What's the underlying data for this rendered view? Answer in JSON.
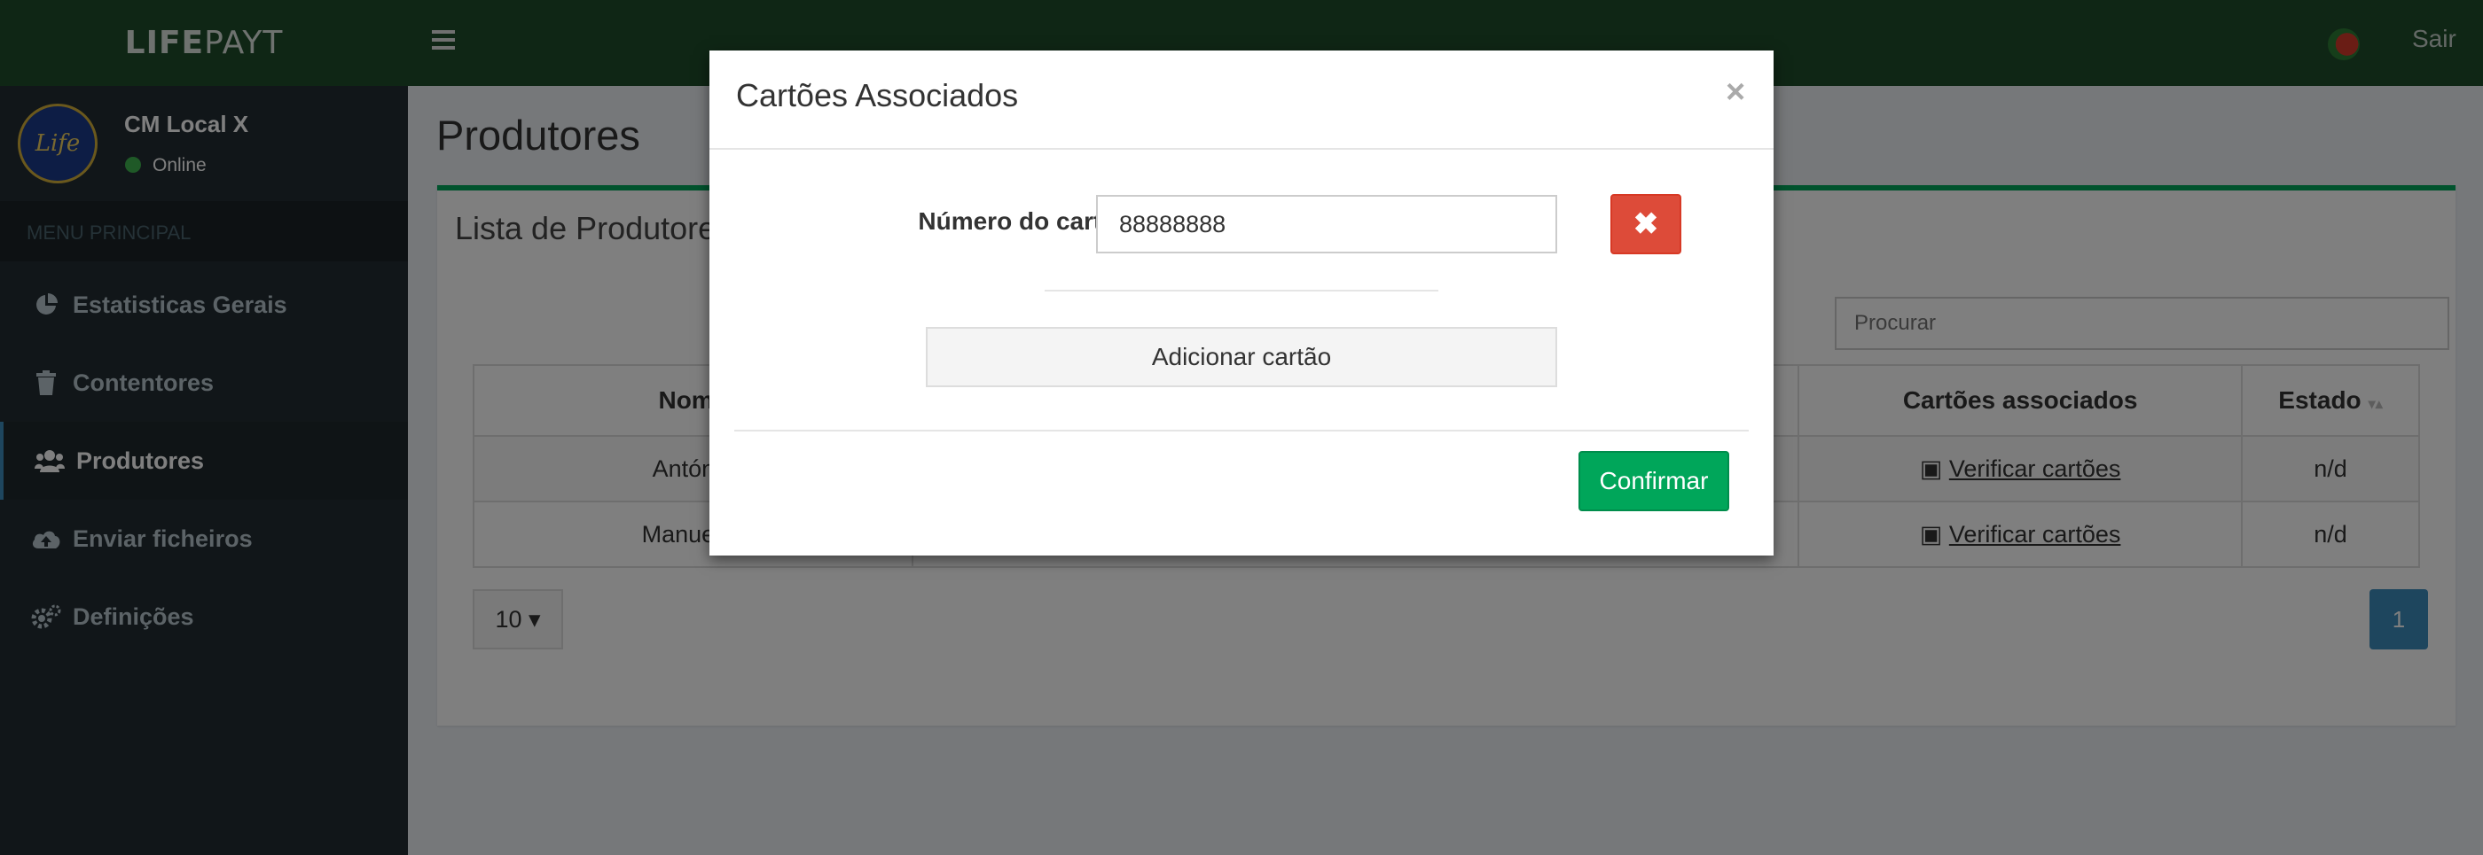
{
  "header": {
    "logo": {
      "bold": "LIFE",
      "rest": "PAYT"
    },
    "logout_label": "Sair"
  },
  "sidebar": {
    "user": {
      "name": "CM Local X",
      "status": "Online",
      "avatar_text": "Life"
    },
    "menu_header": "MENU PRINCIPAL",
    "items": [
      {
        "label": "Estatisticas Gerais",
        "icon": "pie-chart-icon"
      },
      {
        "label": "Contentores",
        "icon": "trash-icon"
      },
      {
        "label": "Produtores",
        "icon": "users-icon",
        "active": true
      },
      {
        "label": "Enviar ficheiros",
        "icon": "cloud-upload-icon"
      },
      {
        "label": "Definições",
        "icon": "gears-icon"
      }
    ]
  },
  "main": {
    "page_title": "Produtores",
    "box_title": "Lista de Produtores",
    "search_placeholder": "Procurar",
    "table": {
      "columns": [
        "Nome",
        "",
        "Cartões associados",
        "Estado"
      ],
      "rows": [
        {
          "name": "António",
          "cards_link": "Verificar cartões",
          "status": "n/d"
        },
        {
          "name": "Manuel C",
          "cards_link": "Verificar cartões",
          "status": "n/d"
        }
      ]
    },
    "page_size": "10",
    "current_page": "1"
  },
  "modal": {
    "title": "Cartões Associados",
    "close_symbol": "×",
    "field_label": "Número do cartão",
    "field_value": "88888888",
    "remove_symbol": "✖",
    "add_label": "Adicionar cartão",
    "confirm_label": "Confirmar"
  },
  "colors": {
    "header": "#1e4d2b",
    "sidebar": "#222d32",
    "accent_green": "#00a65a",
    "danger": "#dd4b39",
    "primary": "#3c8dbc"
  }
}
